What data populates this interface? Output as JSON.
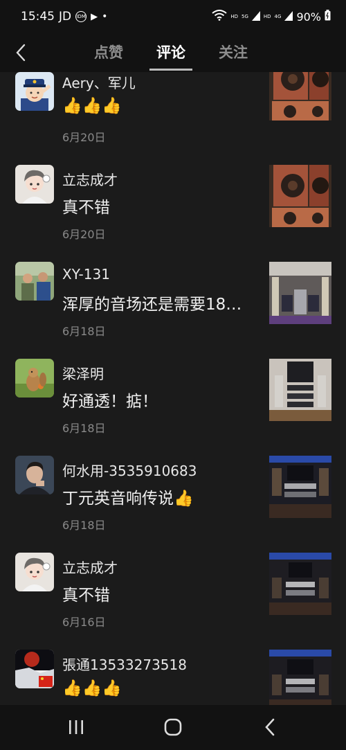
{
  "status": {
    "time": "15:45",
    "carrier": "JD",
    "idm": "IDM",
    "hd1": "HD",
    "sig5g": "5G",
    "hd2": "HD",
    "sig4g": "4G",
    "battery": "90%"
  },
  "header": {
    "tabs": [
      {
        "label": "点赞"
      },
      {
        "label": "评论"
      },
      {
        "label": "关注"
      }
    ]
  },
  "colors": {
    "background": "#1b1b1b",
    "bar": "#121212",
    "date": "#8a8a8a",
    "active_tab": "#ffffff",
    "inactive_tab": "#8d8d8d"
  },
  "comments": [
    {
      "name": "Aery、军儿",
      "content": "👍👍👍",
      "date": "6月20日",
      "avatar": "cartoon-officer-avatar",
      "thumb": "wooden-speakers-thumb"
    },
    {
      "name": "立志成才",
      "content": "真不错",
      "date": "6月20日",
      "avatar": "cartoon-boy-avatar",
      "thumb": "wooden-speakers-thumb"
    },
    {
      "name": "XY-131",
      "content": "浑厚的音场还是需要18…",
      "date": "6月18日",
      "avatar": "people-photo-avatar",
      "thumb": "audio-room-thumb"
    },
    {
      "name": "梁泽明",
      "content": "好通透！掂！",
      "date": "6月18日",
      "avatar": "chipmunk-avatar",
      "thumb": "hifi-rack-thumb"
    },
    {
      "name": "何水用-3535910683",
      "content": "丁元英音响传说👍",
      "date": "6月18日",
      "avatar": "man-portrait-avatar",
      "thumb": "hifi-shop-thumb"
    },
    {
      "name": "立志成才",
      "content": "真不错",
      "date": "6月16日",
      "avatar": "cartoon-boy-avatar",
      "thumb": "hifi-shop-thumb"
    },
    {
      "name": "張通13533273518",
      "content": "👍👍👍",
      "date": "",
      "avatar": "moon-flag-avatar",
      "thumb": "hifi-shop-thumb"
    }
  ]
}
